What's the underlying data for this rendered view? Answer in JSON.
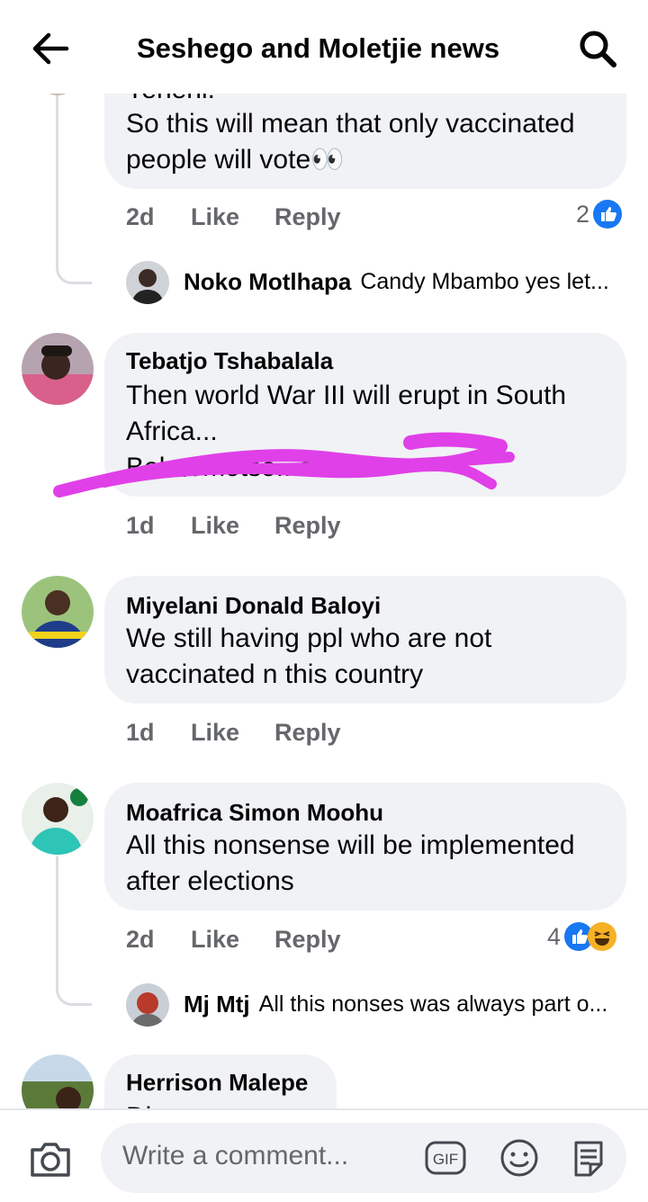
{
  "header": {
    "title": "Seshego and Moletjie news",
    "back_icon": "back-arrow-icon",
    "search_icon": "search-icon"
  },
  "comments": [
    {
      "truncated_top_text": "Yeheni.",
      "text": "So this will mean that only vaccinated people will vote👀",
      "time": "2d",
      "like": "Like",
      "reply": "Reply",
      "reaction_count": "2",
      "reactions": [
        "like"
      ],
      "reply_preview": {
        "name": "Noko Motlhapa",
        "text": "Candy Mbambo yes let..."
      }
    },
    {
      "author": "Tebatjo Tshabalala",
      "text": "Then world War III will erupt in South Africa...",
      "scribbled_line": "Bokgomotso...ola",
      "time": "1d",
      "like": "Like",
      "reply": "Reply"
    },
    {
      "author": "Miyelani Donald Baloyi",
      "text": "We still having ppl who are not vaccinated n this country",
      "time": "1d",
      "like": "Like",
      "reply": "Reply"
    },
    {
      "author": "Moafrica Simon Moohu",
      "text": "All this nonsense will be implemented after elections",
      "time": "2d",
      "like": "Like",
      "reply": "Reply",
      "reaction_count": "4",
      "reactions": [
        "like",
        "haha"
      ],
      "reply_preview": {
        "name": "Mj Mtj",
        "text": "All this nonses was always part o..."
      }
    },
    {
      "author": "Herrison Malepe",
      "text": "Di..."
    }
  ],
  "composer": {
    "placeholder": "Write a comment...",
    "gif_label": "GIF",
    "camera_icon": "camera-icon",
    "emoji_icon": "emoji-icon",
    "sticker_icon": "sticker-icon"
  },
  "colors": {
    "bubble": "#f0f2f5",
    "meta_text": "#65676b",
    "like_blue": "#1877f2",
    "haha_yellow": "#f7b125",
    "scribble_magenta": "#e040e8"
  }
}
